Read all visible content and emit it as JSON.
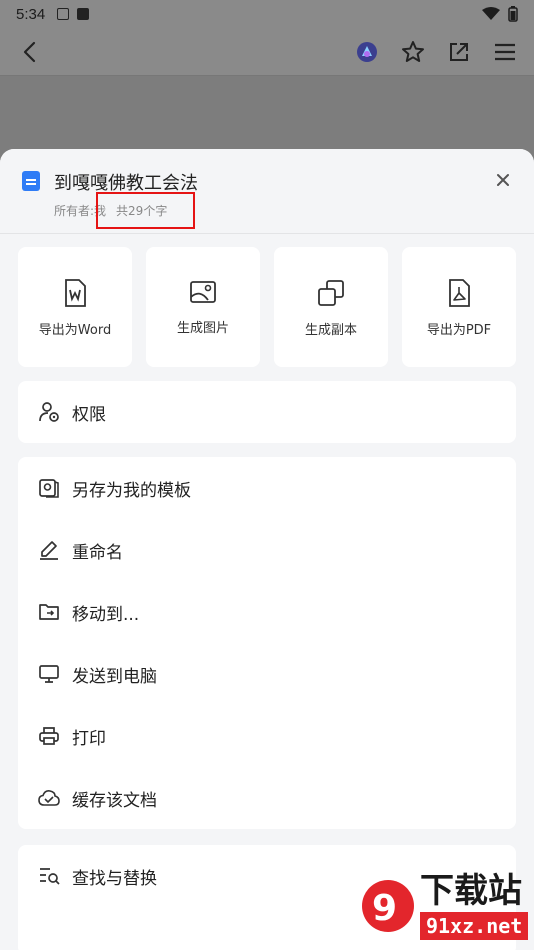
{
  "status_bar": {
    "time": "5:34"
  },
  "document": {
    "title": "到嘎嘎佛教工会法",
    "owner_label": "所有者:我",
    "word_count": "共29个字"
  },
  "quick_actions": [
    {
      "label": "导出为Word",
      "icon": "word-file-icon"
    },
    {
      "label": "生成图片",
      "icon": "image-icon"
    },
    {
      "label": "生成副本",
      "icon": "copy-icon"
    },
    {
      "label": "导出为PDF",
      "icon": "pdf-file-icon"
    }
  ],
  "permissions": {
    "label": "权限",
    "icon": "user-settings-icon"
  },
  "menu": [
    {
      "label": "另存为我的模板",
      "icon": "template-icon"
    },
    {
      "label": "重命名",
      "icon": "pencil-icon"
    },
    {
      "label": "移动到...",
      "icon": "folder-move-icon"
    },
    {
      "label": "发送到电脑",
      "icon": "monitor-icon"
    },
    {
      "label": "打印",
      "icon": "printer-icon"
    },
    {
      "label": "缓存该文档",
      "icon": "cloud-check-icon"
    }
  ],
  "find": {
    "label": "查找与替换",
    "icon": "find-replace-icon"
  },
  "watermark": {
    "brand": "下载站",
    "domain": "91xz.net"
  },
  "colors": {
    "accent": "#2f7cf6",
    "highlight": "#e51414",
    "watermark": "#e3262c"
  }
}
